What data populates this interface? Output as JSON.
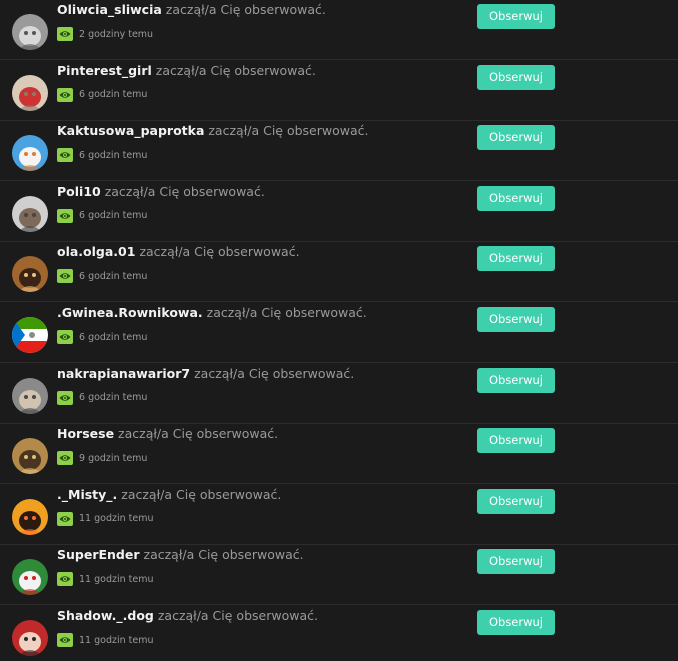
{
  "action_text": "zaczął/a Cię obserwować.",
  "follow_label": "Obserwuj",
  "notifications": [
    {
      "username": "Oliwcia_sliwcia",
      "time": "2 godziny temu",
      "avatar_icon": "gray-cat-avatar",
      "avatar_colors": [
        "#9a9a9a",
        "#d8d8d8",
        "#555555"
      ]
    },
    {
      "username": "Pinterest_girl",
      "time": "6 godzin temu",
      "avatar_icon": "santa-cat-avatar",
      "avatar_colors": [
        "#d9cbb8",
        "#cc3333",
        "#8c7a6a"
      ]
    },
    {
      "username": "Kaktusowa_paprotka",
      "time": "6 godzin temu",
      "avatar_icon": "snowman-avatar",
      "avatar_colors": [
        "#4aa3e0",
        "#f4f4f4",
        "#e07b30"
      ]
    },
    {
      "username": "Poli10",
      "time": "6 godzin temu",
      "avatar_icon": "hamster-avatar",
      "avatar_colors": [
        "#cfcfcf",
        "#7d6a58",
        "#444444"
      ]
    },
    {
      "username": "ola.olga.01",
      "time": "6 godzin temu",
      "avatar_icon": "owl-avatar",
      "avatar_colors": [
        "#a0662e",
        "#3a2415",
        "#f0c080"
      ]
    },
    {
      "username": ".Gwinea.Rownikowa.",
      "time": "6 godzin temu",
      "avatar_icon": "equatorial-guinea-flag-avatar",
      "avatar_colors": [
        "#3e9a00",
        "#ffffff",
        "#e32118"
      ]
    },
    {
      "username": "nakrapianawarior7",
      "time": "6 godzin temu",
      "avatar_icon": "spotted-cat-avatar",
      "avatar_colors": [
        "#8a8a8a",
        "#d0c4b0",
        "#4a4a4a"
      ]
    },
    {
      "username": "Horsese",
      "time": "9 godzin temu",
      "avatar_icon": "horse-avatar",
      "avatar_colors": [
        "#b38a4a",
        "#4a3520",
        "#e0c080"
      ]
    },
    {
      "username": "._Misty_.",
      "time": "11 godzin temu",
      "avatar_icon": "sunset-silhouette-avatar",
      "avatar_colors": [
        "#f0a020",
        "#2a1a10",
        "#ff7030"
      ]
    },
    {
      "username": "SuperEnder",
      "time": "11 godzin temu",
      "avatar_icon": "christmas-avatar",
      "avatar_colors": [
        "#2f8a3a",
        "#f2f2f2",
        "#d02020"
      ]
    },
    {
      "username": "Shadow._.dog",
      "time": "11 godzin temu",
      "avatar_icon": "red-hair-girl-avatar",
      "avatar_colors": [
        "#c02a2a",
        "#f0d0c0",
        "#2a2a2a"
      ]
    }
  ],
  "colors": {
    "background": "#1b1b1b",
    "divider": "#2c2c2c",
    "button": "#3ecfad",
    "eye_badge": "#8dd04a",
    "username": "#f2f2f2",
    "secondary_text": "#9a9a9a"
  }
}
